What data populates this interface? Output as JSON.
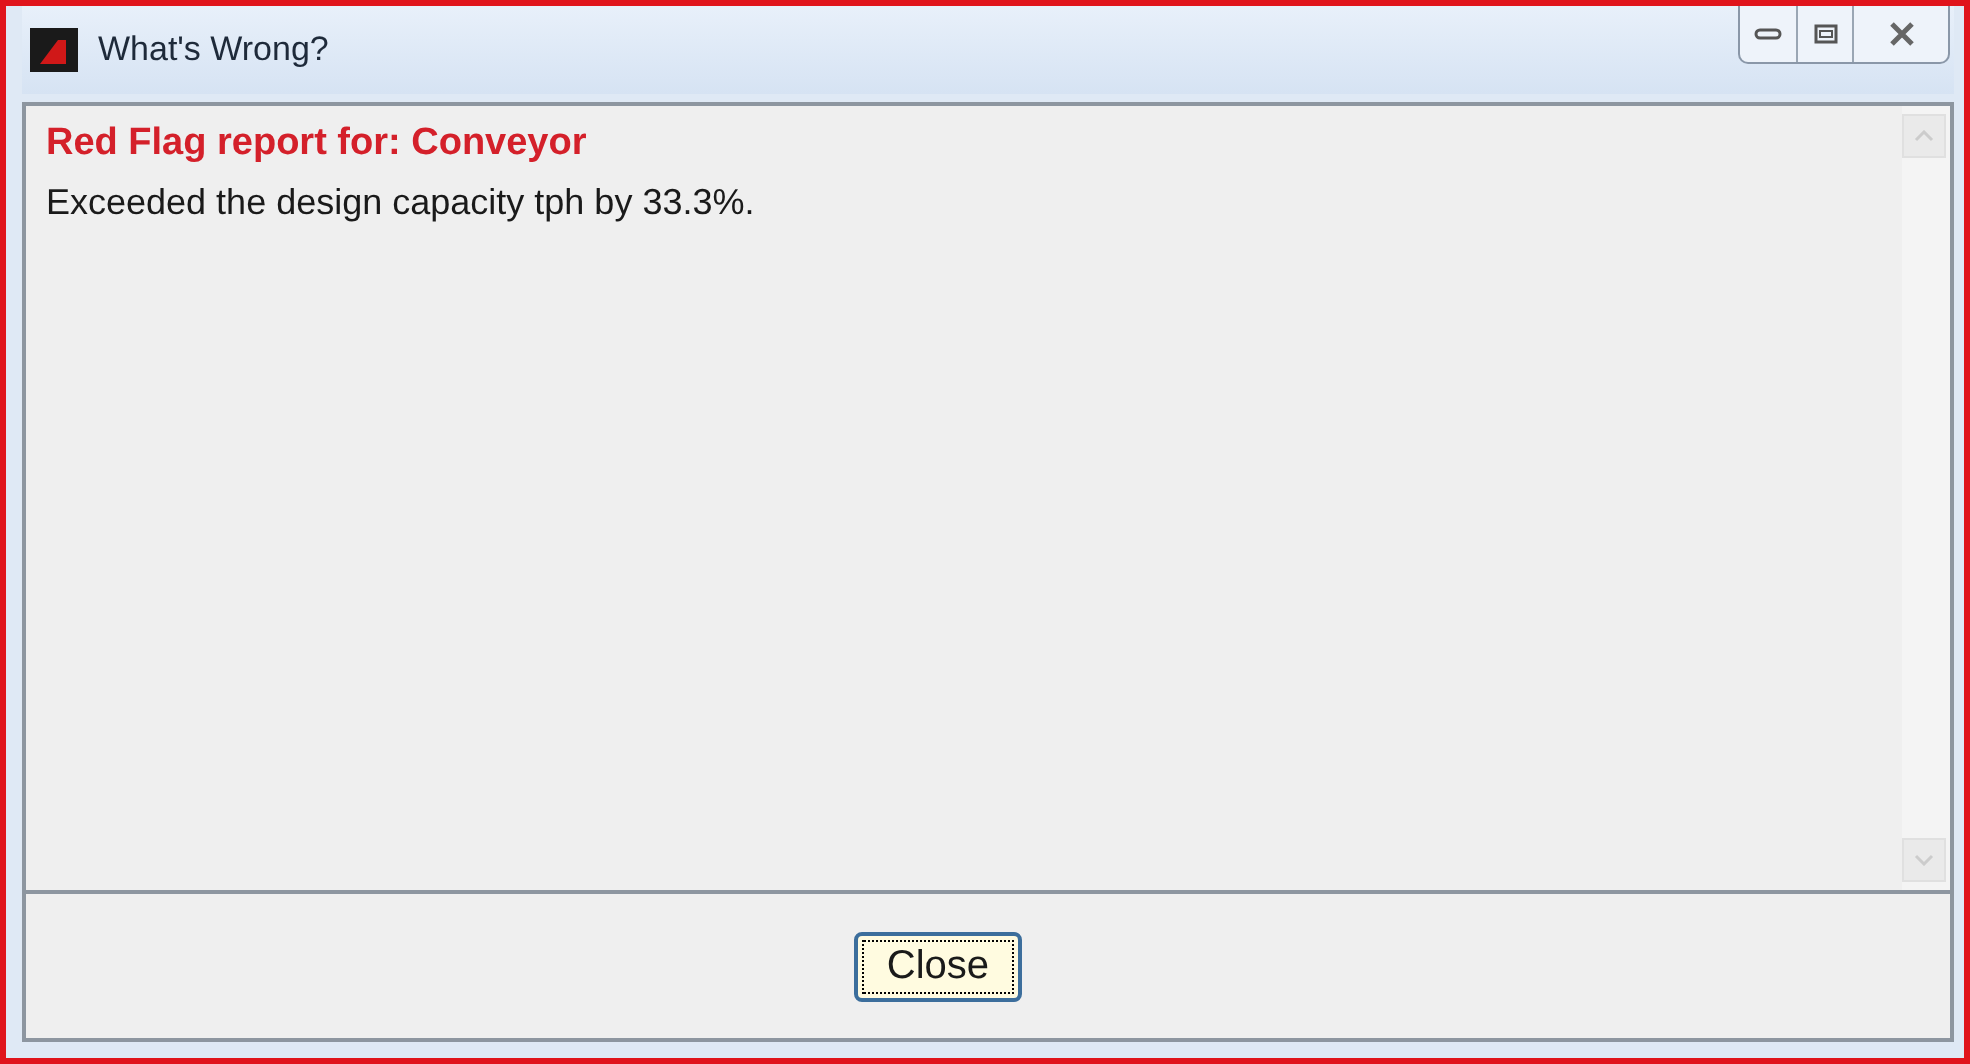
{
  "window": {
    "title": "What's Wrong?"
  },
  "report": {
    "heading": "Red Flag report for: Conveyor",
    "message": "Exceeded the design capacity tph by 33.3%."
  },
  "buttons": [
    {
      "label": "Close",
      "focused": true
    }
  ]
}
